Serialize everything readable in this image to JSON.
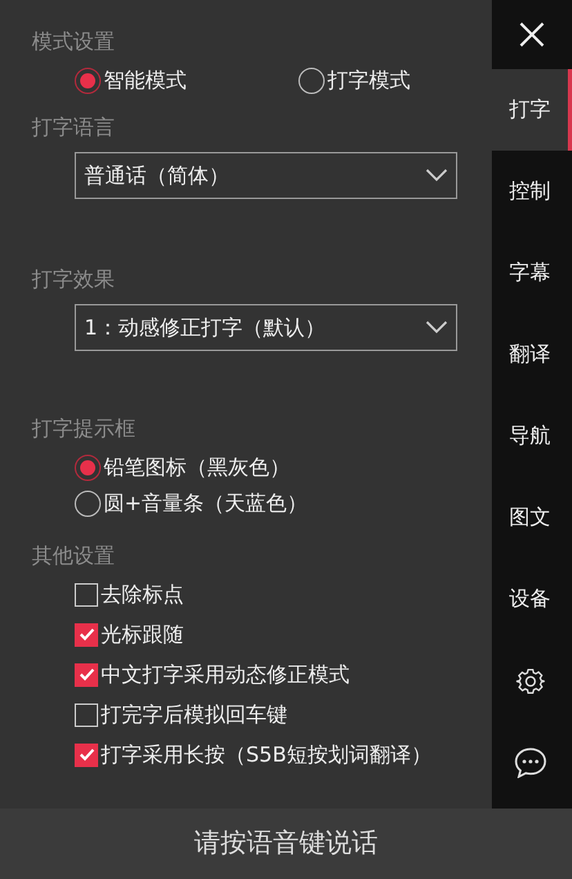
{
  "sections": [
    {
      "title": "模式设置",
      "kind": "radio-inline",
      "options": [
        {
          "label": "智能模式",
          "selected": true
        },
        {
          "label": "打字模式",
          "selected": false
        }
      ]
    },
    {
      "title": "打字语言",
      "kind": "select",
      "value": "普通话（简体）"
    },
    {
      "title": "打字效果",
      "kind": "select",
      "value": "1：动感修正打字（默认）"
    },
    {
      "title": "打字提示框",
      "kind": "radio",
      "options": [
        {
          "label": "铅笔图标（黑灰色）",
          "selected": true
        },
        {
          "label": "圆+音量条（天蓝色）",
          "selected": false
        }
      ]
    },
    {
      "title": "其他设置",
      "kind": "checkbox",
      "options": [
        {
          "label": "去除标点",
          "checked": false
        },
        {
          "label": "光标跟随",
          "checked": true
        },
        {
          "label": "中文打字采用动态修正模式",
          "checked": true
        },
        {
          "label": "打完字后模拟回车键",
          "checked": false
        },
        {
          "label": "打字采用长按（S5B短按划词翻译）",
          "checked": true
        }
      ]
    }
  ],
  "sidebar": {
    "tabs": [
      {
        "kind": "text",
        "label": "打字",
        "selected": true
      },
      {
        "kind": "text",
        "label": "控制",
        "selected": false
      },
      {
        "kind": "text",
        "label": "字幕",
        "selected": false
      },
      {
        "kind": "text",
        "label": "翻译",
        "selected": false
      },
      {
        "kind": "text",
        "label": "导航",
        "selected": false
      },
      {
        "kind": "text",
        "label": "图文",
        "selected": false
      },
      {
        "kind": "text",
        "label": "设备",
        "selected": false
      },
      {
        "kind": "settings",
        "selected": false
      },
      {
        "kind": "chat",
        "selected": false
      }
    ]
  },
  "status_bar": {
    "text": "请按语音键说话"
  }
}
